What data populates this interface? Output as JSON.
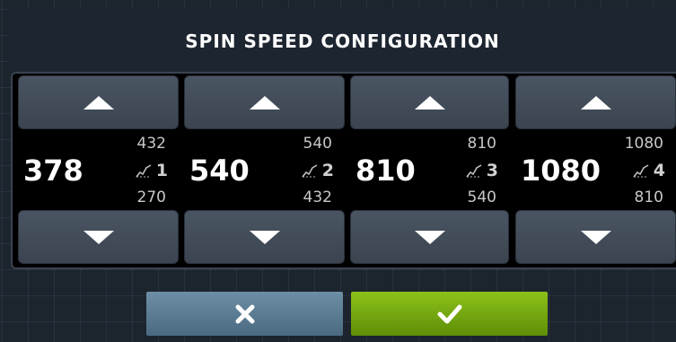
{
  "header": {
    "title": "SPIN SPEED CONFIGURATION"
  },
  "slots": [
    {
      "index": "1",
      "speed": "378",
      "max": "432",
      "min": "270"
    },
    {
      "index": "2",
      "speed": "540",
      "max": "540",
      "min": "432"
    },
    {
      "index": "3",
      "speed": "810",
      "max": "810",
      "min": "540"
    },
    {
      "index": "4",
      "speed": "1080",
      "max": "1080",
      "min": "810"
    }
  ],
  "icons": {
    "increase": "triangle-up-icon",
    "decrease": "triangle-down-icon",
    "mode": "spin-curve-icon",
    "cancel": "close-icon",
    "confirm": "checkmark-icon"
  },
  "colors": {
    "background": "#1c242d",
    "panel": "#000000",
    "button": "#434d5a",
    "cancel": "#5b7b93",
    "confirm": "#76a810"
  }
}
